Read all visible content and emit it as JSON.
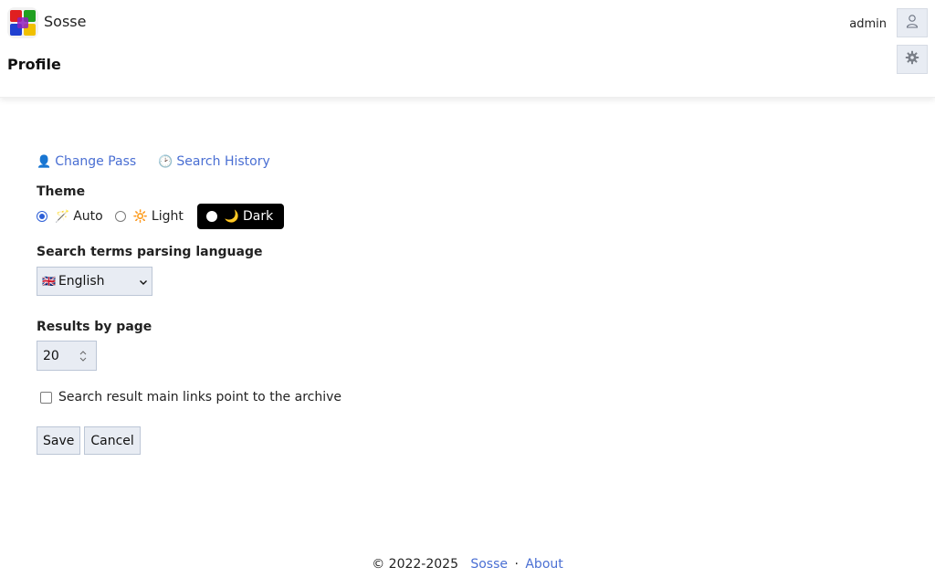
{
  "header": {
    "app_name": "Sosse",
    "page_title": "Profile",
    "username": "admin",
    "icons": [
      "sosse-logo",
      "user-icon",
      "gear-icon"
    ]
  },
  "links": {
    "change_pass": {
      "emoji": "👤",
      "label": "Change Pass"
    },
    "search_history": {
      "emoji": "🕑",
      "label": "Search History"
    }
  },
  "theme": {
    "label": "Theme",
    "options": [
      {
        "emoji": "🪄",
        "label": "Auto",
        "checked": true
      },
      {
        "emoji": "🔆",
        "label": "Light",
        "checked": false
      },
      {
        "emoji": "🌙",
        "label": "Dark",
        "checked": false
      }
    ]
  },
  "language": {
    "label": "Search terms parsing language",
    "selected_flag": "🇬🇧",
    "selected": "English"
  },
  "results": {
    "label": "Results by page",
    "value": "20"
  },
  "archive": {
    "label": "Search result main links point to the archive",
    "checked": false
  },
  "buttons": {
    "save": "Save",
    "cancel": "Cancel"
  },
  "footer": {
    "copyright": "© 2022-2025",
    "sosse_link": "Sosse",
    "separator": "·",
    "about_link": "About"
  },
  "colors": {
    "accent": "#4a6fd3",
    "input_bg": "#e8ecf3",
    "dark_theme_bg": "#000000"
  }
}
